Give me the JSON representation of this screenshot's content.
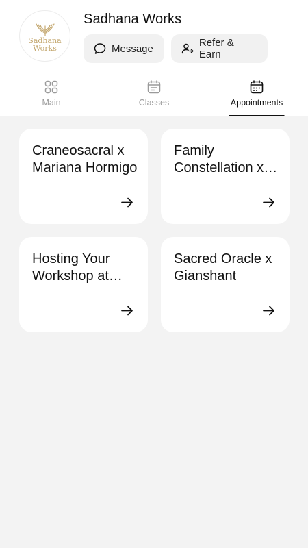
{
  "header": {
    "logo_text_line1": "Sadhana",
    "logo_text_line2": "Works",
    "title": "Sadhana Works",
    "message_label": "Message",
    "refer_label": "Refer & Earn"
  },
  "tabs": [
    {
      "label": "Main",
      "icon": "grid-icon",
      "active": false
    },
    {
      "label": "Classes",
      "icon": "calendar-list-icon",
      "active": false
    },
    {
      "label": "Appointments",
      "icon": "calendar-icon",
      "active": true
    }
  ],
  "cards": [
    {
      "title": "Craneosacral x Mariana Hormigo"
    },
    {
      "title": "Family Constellation x Sandra"
    },
    {
      "title": "Hosting Your Workshop at Sadhana"
    },
    {
      "title": "Sacred Oracle x Gianshant"
    }
  ],
  "colors": {
    "background": "#f3f3f3",
    "card": "#ffffff",
    "logo_gold": "#c4a870",
    "pill": "#f1f1f1",
    "inactive_tab": "#9a9a9a"
  }
}
